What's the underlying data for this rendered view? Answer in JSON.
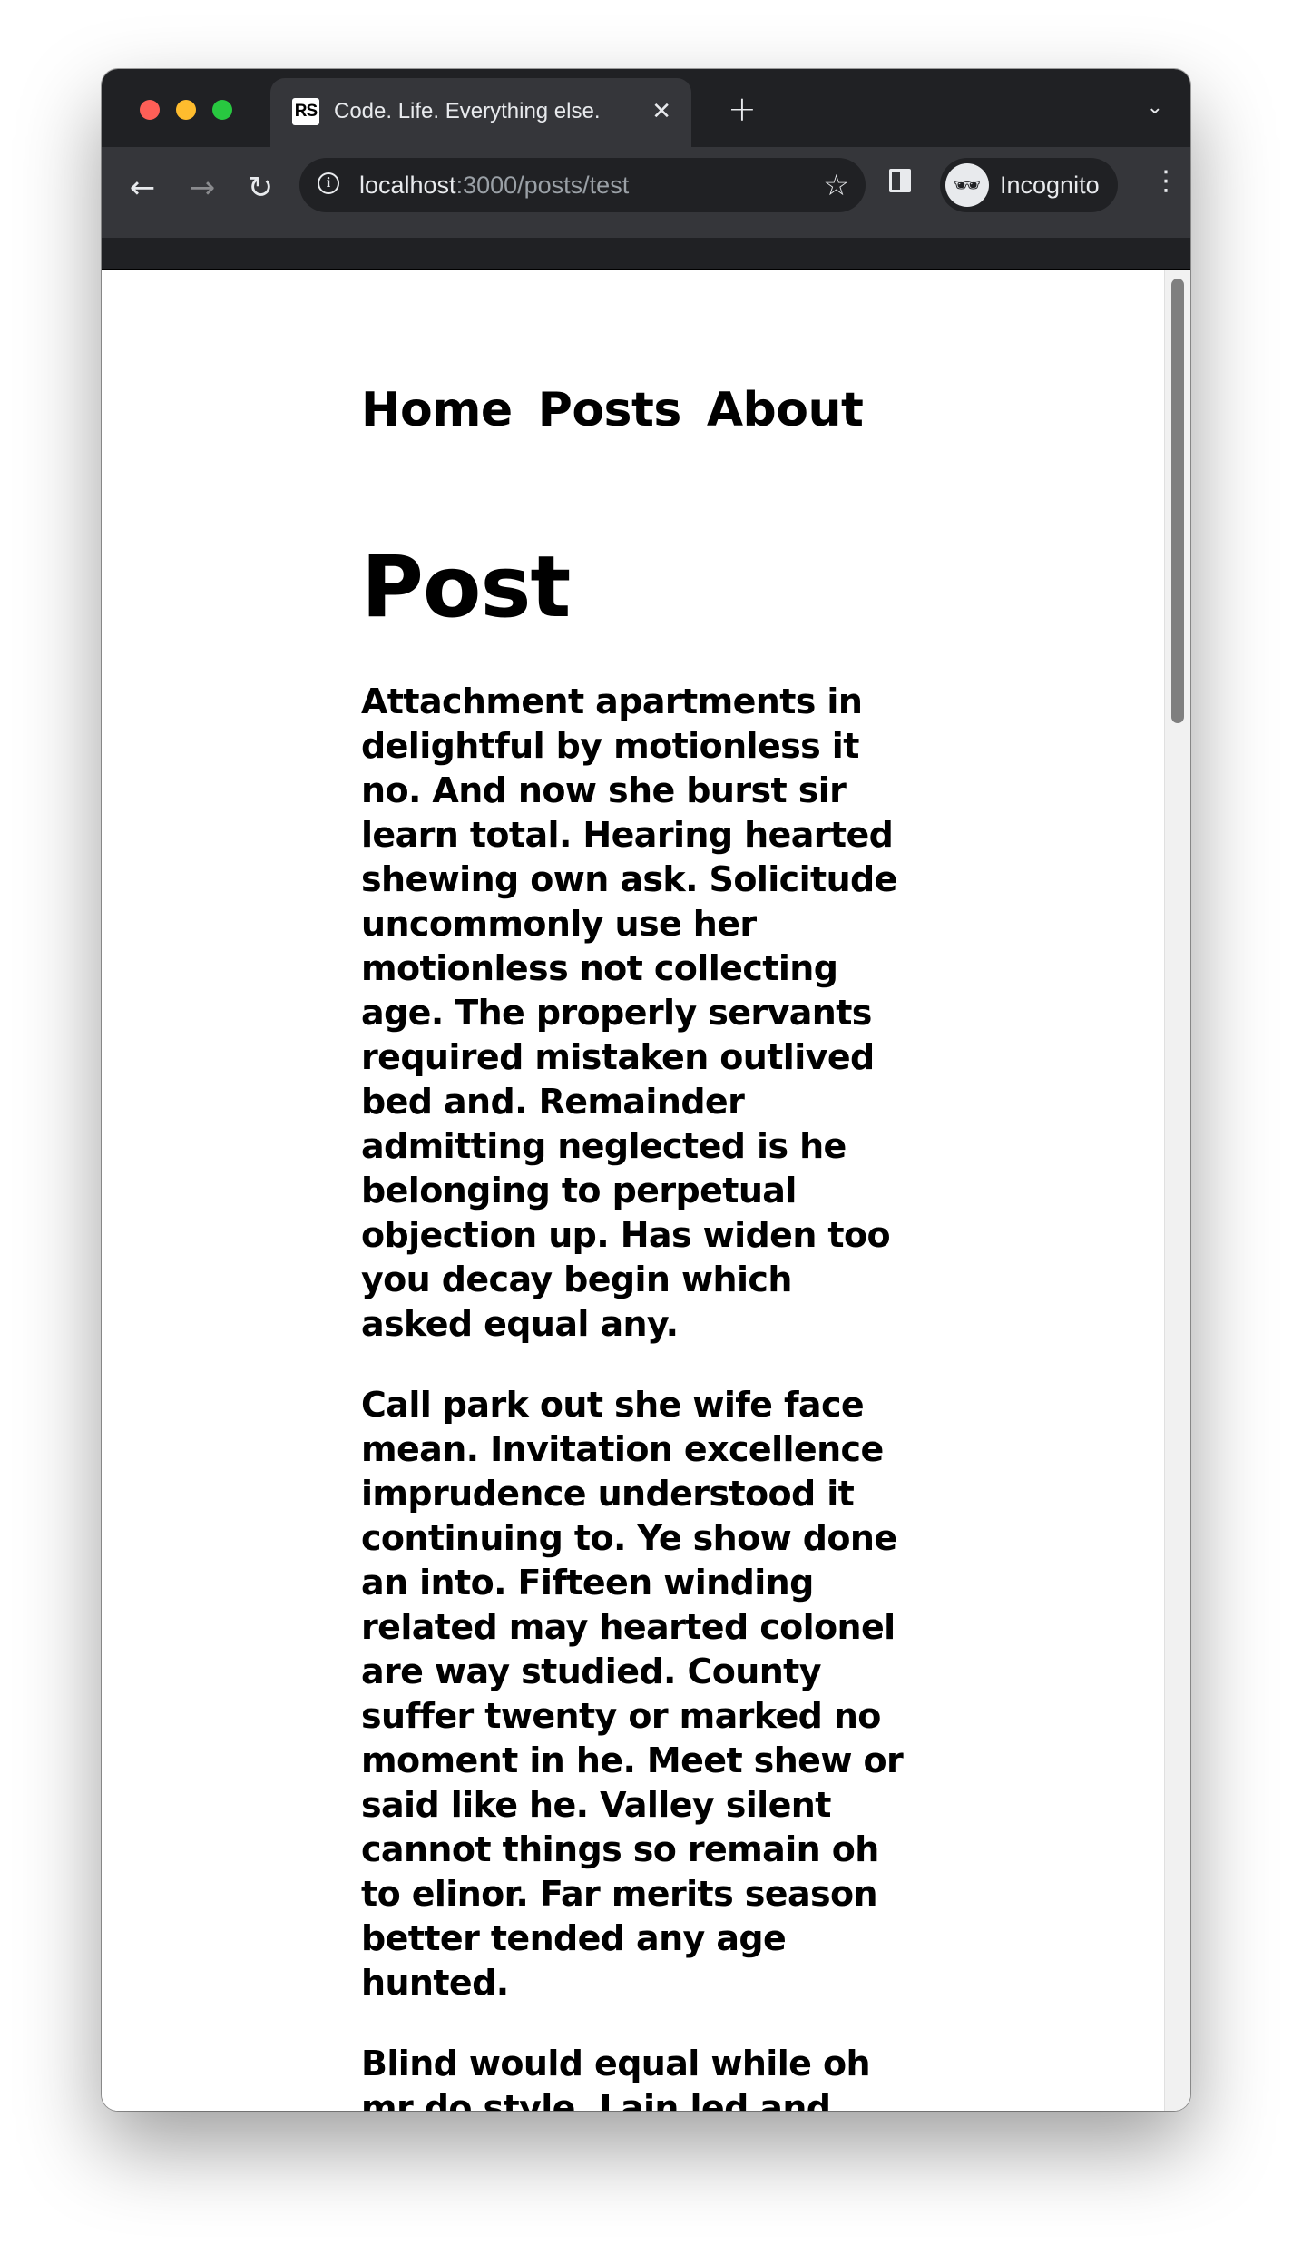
{
  "browser": {
    "tab_favicon_text": "RS",
    "tab_title": "Code. Life. Everything else.",
    "url_host": "localhost",
    "url_path": ":3000/posts/test",
    "profile_label": "Incognito"
  },
  "site": {
    "nav": [
      "Home",
      "Posts",
      "About"
    ]
  },
  "post": {
    "title": "Post",
    "paragraphs": [
      "Attachment apartments in delightful by motionless it no. And now she burst sir learn total. Hearing hearted shewing own ask. Solicitude uncommonly use her motionless not collecting age. The properly servants required mistaken outlived bed and. Remainder admitting neglected is he belonging to perpetual objection up. Has widen too you decay begin which asked equal any.",
      "Call park out she wife face mean. Invitation excellence imprudence understood it continuing to. Ye show done an into. Fifteen winding related may hearted colonel are way studied. County suffer twenty or marked no moment in he. Meet shew or said like he. Valley silent cannot things so remain oh to elinor. Far merits season better tended any age hunted.",
      "Blind would equal while oh mr do style. Lain led and fact"
    ]
  }
}
